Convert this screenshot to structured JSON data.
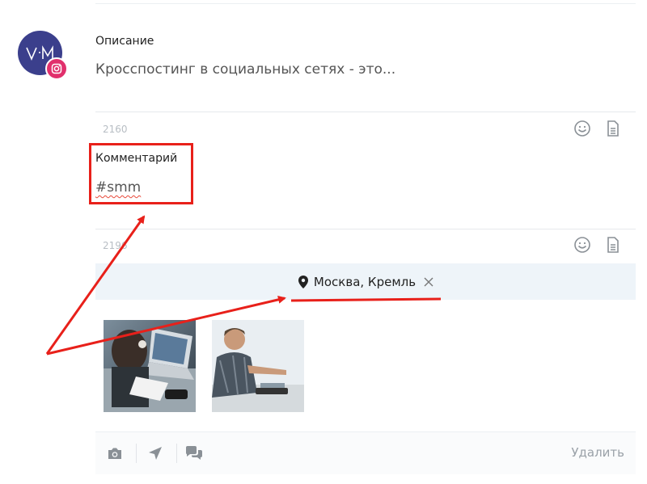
{
  "description": {
    "label": "Описание",
    "text": "Кросспостинг в социальных сетях - это...",
    "counter": "2160"
  },
  "comment": {
    "label": "Комментарий",
    "text": "#smm",
    "counter": "2196"
  },
  "location": {
    "text": "Москва, Кремль"
  },
  "toolbar": {
    "delete_label": "Удалить"
  },
  "colors": {
    "avatar_bg": "#3b3f8c",
    "instagram_badge": "#e1306c",
    "annotation_red": "#e8201a",
    "location_bg": "#eef4f9"
  },
  "icons": {
    "avatar": "vm-logo-icon",
    "badge": "instagram-icon",
    "emoji": "smiley-icon",
    "template": "document-icon",
    "location": "map-pin-icon",
    "remove": "close-icon",
    "photo": "camera-icon",
    "send": "send-arrow-icon",
    "chat": "chat-bubbles-icon"
  }
}
